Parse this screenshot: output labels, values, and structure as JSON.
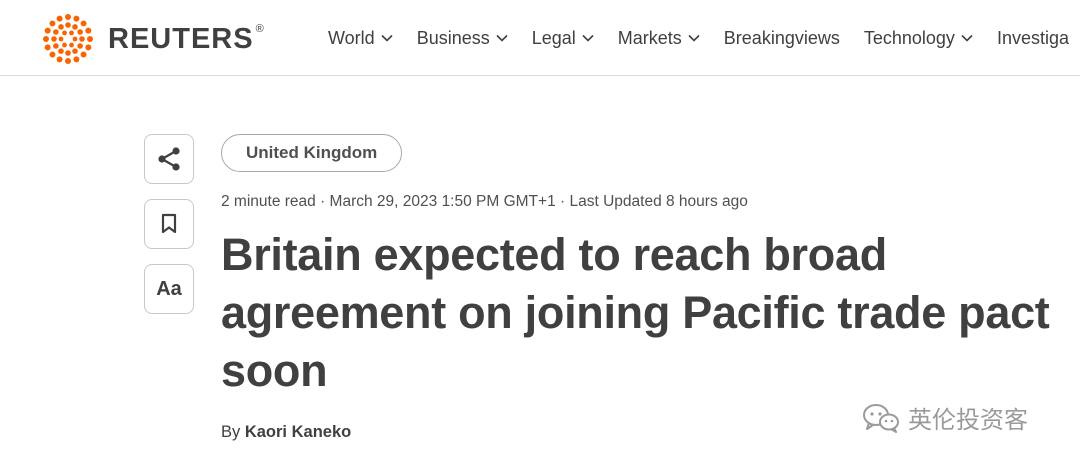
{
  "brand": {
    "name": "REUTERS",
    "reg": "®",
    "color": "#fa6400"
  },
  "nav": [
    {
      "label": "World",
      "has_dropdown": true
    },
    {
      "label": "Business",
      "has_dropdown": true
    },
    {
      "label": "Legal",
      "has_dropdown": true
    },
    {
      "label": "Markets",
      "has_dropdown": true
    },
    {
      "label": "Breakingviews",
      "has_dropdown": false
    },
    {
      "label": "Technology",
      "has_dropdown": true
    },
    {
      "label": "Investiga",
      "has_dropdown": false
    }
  ],
  "toolbar": {
    "share_icon": "share-icon",
    "bookmark_icon": "bookmark-icon",
    "text_size_label": "Aa"
  },
  "article": {
    "category": "United Kingdom",
    "meta": "2 minute read · March 29, 2023 1:50 PM GMT+1 · Last Updated 8 hours ago",
    "headline": "Britain expected to reach broad agreement on joining Pacific trade pact soon",
    "byline_prefix": "By ",
    "author": "Kaori Kaneko"
  },
  "watermark": {
    "icon": "wechat-icon",
    "text": "英伦投资客"
  }
}
